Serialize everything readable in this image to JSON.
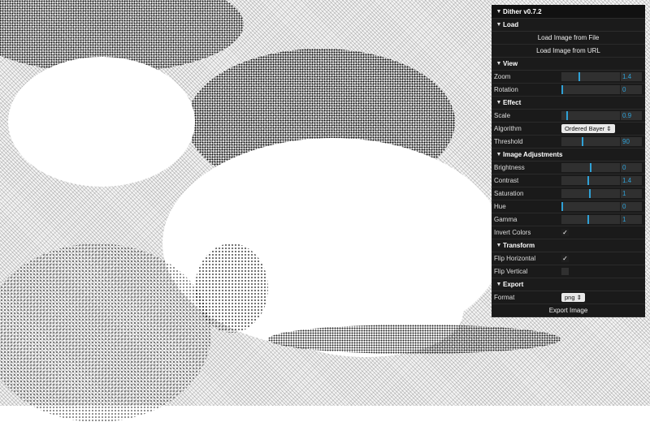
{
  "panel": {
    "title": "Dither v0.7.2",
    "folders": {
      "load": {
        "title": "Load",
        "buttons": [
          "Load Image from File",
          "Load Image from URL"
        ]
      },
      "view": {
        "title": "View",
        "zoom": {
          "label": "Zoom",
          "value": "1.4",
          "fraction": 0.3
        },
        "rotation": {
          "label": "Rotation",
          "value": "0",
          "fraction": 0.0
        }
      },
      "effect": {
        "title": "Effect",
        "scale": {
          "label": "Scale",
          "value": "0.9",
          "fraction": 0.08
        },
        "algorithm": {
          "label": "Algorithm",
          "value": "Ordered Bayer"
        },
        "threshold": {
          "label": "Threshold",
          "value": "90",
          "fraction": 0.35
        }
      },
      "adjustments": {
        "title": "Image Adjustments",
        "brightness": {
          "label": "Brightness",
          "value": "0",
          "fraction": 0.5
        },
        "contrast": {
          "label": "Contrast",
          "value": "1.4",
          "fraction": 0.45
        },
        "saturation": {
          "label": "Saturation",
          "value": "1",
          "fraction": 0.48
        },
        "hue": {
          "label": "Hue",
          "value": "0",
          "fraction": 0.0
        },
        "gamma": {
          "label": "Gamma",
          "value": "1",
          "fraction": 0.45
        },
        "invert": {
          "label": "Invert Colors",
          "checked": true
        }
      },
      "transform": {
        "title": "Transform",
        "flip_h": {
          "label": "Flip Horizontal",
          "checked": true
        },
        "flip_v": {
          "label": "Flip Vertical",
          "checked": false
        }
      },
      "export": {
        "title": "Export",
        "format": {
          "label": "Format",
          "value": "png"
        },
        "button": "Export Image"
      }
    }
  },
  "colors": {
    "panel_bg": "#1a1a1a",
    "accent": "#2fa1d6",
    "field_bg": "#303030"
  },
  "icons": {
    "caret": "caret-down-icon",
    "check": "checkmark-icon",
    "select_arrows": "up-down-arrows-icon"
  }
}
